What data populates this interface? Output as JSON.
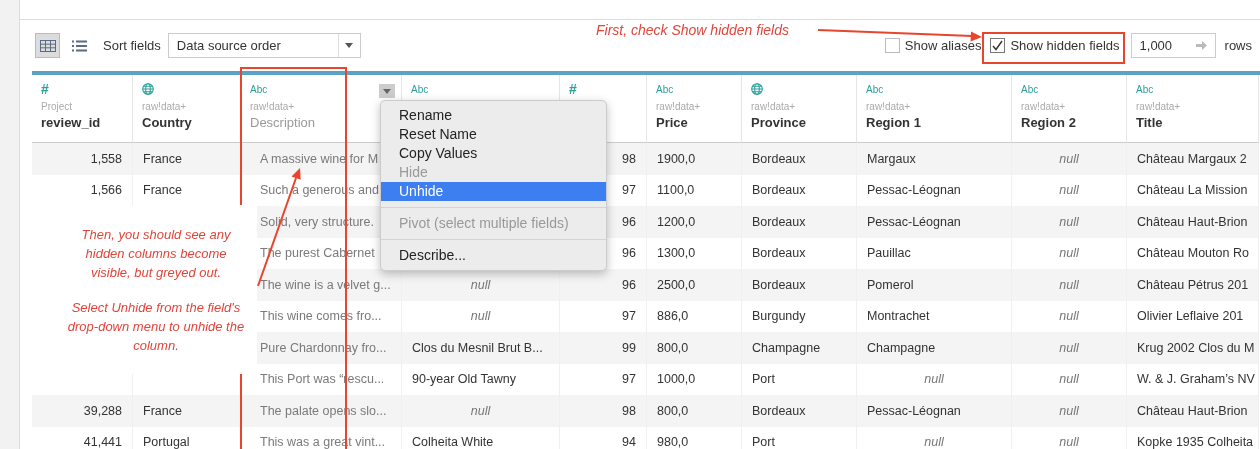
{
  "toolbar": {
    "views": [
      {
        "kind": "grid",
        "selected": true
      },
      {
        "kind": "list",
        "selected": false
      }
    ],
    "sort_label": "Sort fields",
    "sort_value": "Data source order",
    "options": [
      {
        "label": "Show aliases",
        "checked": false
      },
      {
        "label": "Show hidden fields",
        "checked": true
      }
    ],
    "rows_value": "1,000",
    "rows_label": "rows"
  },
  "table": {
    "columns": [
      {
        "kind": "number",
        "icon_text": "#",
        "source": "Project",
        "name": "review_id",
        "hidden": false
      },
      {
        "kind": "geo",
        "source": "raw!data+",
        "name": "Country",
        "hidden": false
      },
      {
        "kind": "text",
        "icon_text": "Abc",
        "source": "raw!data+",
        "name": "Description",
        "hidden": true,
        "menu_button": true
      },
      {
        "kind": "text",
        "icon_text": "Abc"
      },
      {
        "kind": "number",
        "icon_text": "#"
      },
      {
        "kind": "text",
        "icon_text": "Abc",
        "source": "raw!data+",
        "name": "Price",
        "hidden": false
      },
      {
        "kind": "geo",
        "source": "raw!data+",
        "name": "Province",
        "hidden": false
      },
      {
        "kind": "text",
        "icon_text": "Abc",
        "source": "raw!data+",
        "name": "Region 1",
        "hidden": false
      },
      {
        "kind": "text",
        "icon_text": "Abc",
        "source": "raw!data+",
        "name": "Region 2",
        "hidden": false
      },
      {
        "kind": "text",
        "icon_text": "Abc",
        "source": "raw!data+",
        "name": "Title",
        "hidden": false
      }
    ],
    "rows": [
      [
        "1,558",
        "France",
        "A massive wine for M",
        null,
        "98",
        "1900,0",
        "Bordeaux",
        "Margaux",
        {
          "kind": "null",
          "text": "null"
        },
        "Château Margaux 2"
      ],
      [
        "1,566",
        "France",
        "Such a generous and",
        null,
        "97",
        "1100,0",
        "Bordeaux",
        "Pessac-Léognan",
        {
          "kind": "null",
          "text": "null"
        },
        "Château La Mission"
      ],
      [
        null,
        null,
        "Solid, very structure.",
        null,
        "96",
        "1200,0",
        "Bordeaux",
        "Pessac-Léognan",
        {
          "kind": "null",
          "text": "null"
        },
        "Château Haut-Brion"
      ],
      [
        null,
        null,
        "The purest Cabernet",
        null,
        "96",
        "1300,0",
        "Bordeaux",
        "Pauillac",
        {
          "kind": "null",
          "text": "null"
        },
        "Château Mouton Ro"
      ],
      [
        null,
        null,
        "The wine is a velvet g...",
        {
          "kind": "null",
          "text": "null"
        },
        "96",
        "2500,0",
        "Bordeaux",
        "Pomerol",
        {
          "kind": "null",
          "text": "null"
        },
        "Château Pétrus 201"
      ],
      [
        null,
        null,
        "This wine comes fro...",
        {
          "kind": "null",
          "text": "null"
        },
        "97",
        "886,0",
        "Burgundy",
        "Montrachet",
        {
          "kind": "null",
          "text": "null"
        },
        "Olivier Leflaive 201"
      ],
      [
        null,
        null,
        "Pure Chardonnay fro...",
        "Clos du Mesnil Brut B...",
        "99",
        "800,0",
        "Champagne",
        "Champagne",
        {
          "kind": "null",
          "text": "null"
        },
        "Krug 2002 Clos du M"
      ],
      [
        null,
        null,
        "This Port was “rescu...",
        "90-year Old Tawny",
        "97",
        "1000,0",
        "Port",
        {
          "kind": "null",
          "text": "null"
        },
        {
          "kind": "null",
          "text": "null"
        },
        "W. & J. Graham’s NV"
      ],
      [
        "39,288",
        "France",
        "The palate opens slo...",
        {
          "kind": "null",
          "text": "null"
        },
        "98",
        "800,0",
        "Bordeaux",
        "Pessac-Léognan",
        {
          "kind": "null",
          "text": "null"
        },
        "Château Haut-Brion"
      ],
      [
        "41,441",
        "Portugal",
        "This was a great vint...",
        "Colheita White",
        "94",
        "980,0",
        "Port",
        {
          "kind": "null",
          "text": "null"
        },
        {
          "kind": "null",
          "text": "null"
        },
        "Kopke 1935 Colheita"
      ]
    ]
  },
  "context_menu": {
    "items": [
      {
        "kind": "item",
        "label": "Rename",
        "disabled": false,
        "selected": false
      },
      {
        "kind": "item",
        "label": "Reset Name",
        "disabled": false,
        "selected": false
      },
      {
        "kind": "item",
        "label": "Copy Values",
        "disabled": false,
        "selected": false
      },
      {
        "kind": "item",
        "label": "Hide",
        "disabled": true,
        "selected": false
      },
      {
        "kind": "item",
        "label": "Unhide",
        "disabled": false,
        "selected": true
      },
      {
        "kind": "separator"
      },
      {
        "kind": "item",
        "label": "Pivot (select multiple fields)",
        "disabled": true,
        "selected": false
      },
      {
        "kind": "separator"
      },
      {
        "kind": "item",
        "label": "Describe...",
        "disabled": false,
        "selected": false
      }
    ]
  },
  "annotations": {
    "top_note": "First, check Show hidden fields",
    "callout": [
      "Then, you should see any hidden columns become visible, but greyed out.",
      "Select Unhide from the field's drop-down menu to unhide the column."
    ]
  }
}
